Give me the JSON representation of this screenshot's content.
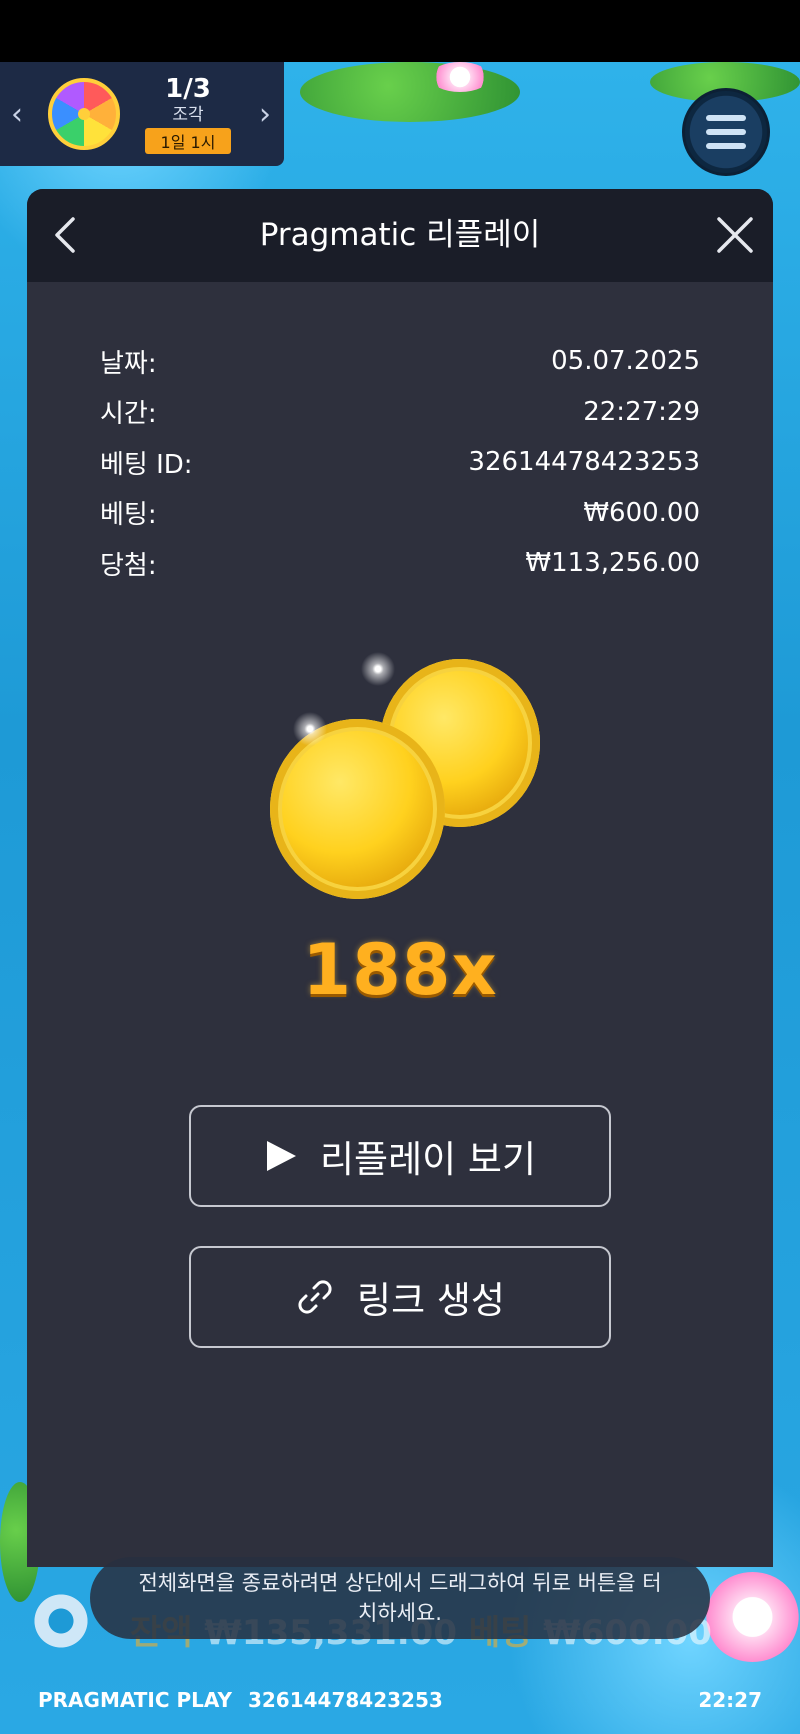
{
  "event_widget": {
    "count": "1/3",
    "label": "조각",
    "timer": "1일 1시"
  },
  "modal": {
    "title": "Pragmatic 리플레이",
    "details": [
      {
        "label": "날짜:",
        "value": "05.07.2025"
      },
      {
        "label": "시간:",
        "value": "22:27:29"
      },
      {
        "label": "베팅 ID:",
        "value": "32614478423253"
      },
      {
        "label": "베팅:",
        "value": "₩600.00"
      },
      {
        "label": "당첨:",
        "value": "₩113,256.00"
      }
    ],
    "multiplier": "188x",
    "replay_button": "리플레이 보기",
    "link_button": "링크 생성"
  },
  "hud": {
    "balance_label": "잔액",
    "balance_value": "₩135,331.00",
    "bet_label": "베팅",
    "bet_value": "₩600.00"
  },
  "toast": {
    "message": "전체화면을 종료하려면 상단에서 드래그하여 뒤로 버튼을 터치하세요."
  },
  "footer": {
    "brand": "PRAGMATIC PLAY",
    "bet_id": "32614478423253",
    "clock": "22:27"
  },
  "colors": {
    "modal_bg": "#2e303d",
    "header_bg": "#1a1d28",
    "accent_gold": "#ffb01f",
    "timer_badge": "#f7a21b"
  },
  "icons": [
    "chevron-left-icon",
    "chevron-right-icon",
    "prize-wheel-icon",
    "hamburger-menu-icon",
    "back-icon",
    "close-icon",
    "coins-icon",
    "play-icon",
    "link-icon",
    "settings-gear-icon"
  ]
}
